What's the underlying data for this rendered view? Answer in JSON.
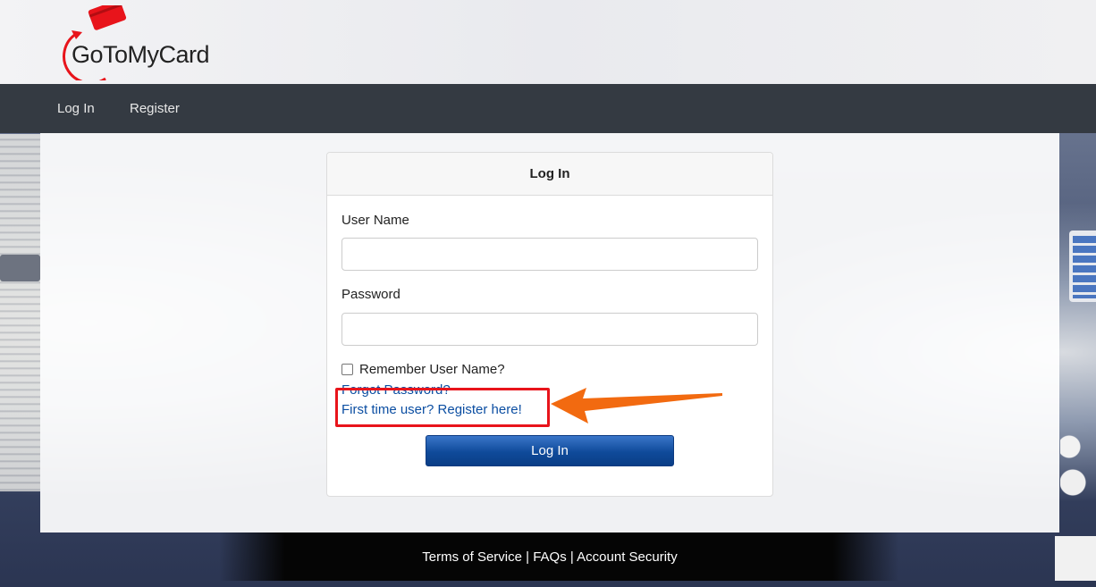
{
  "brand": {
    "name": "GoToMyCard",
    "logo_icon": "credit-card-circular-arrow-icon",
    "accent": "#e8141b"
  },
  "nav": {
    "items": [
      {
        "label": "Log In"
      },
      {
        "label": "Register"
      }
    ]
  },
  "login_card": {
    "title": "Log In",
    "username_label": "User Name",
    "username_value": "",
    "password_label": "Password",
    "password_value": "",
    "remember_label": "Remember User Name?",
    "remember_checked": false,
    "forgot_link": "Forgot Password?",
    "register_link": "First time user? Register here!",
    "submit_label": "Log In"
  },
  "footer": {
    "links": [
      "Terms of Service",
      "FAQs",
      "Account Security"
    ],
    "separator": "|"
  },
  "colors": {
    "navbar": "#343a42",
    "link": "#0b4ea2",
    "button": "#0f4a9a",
    "annotation_box": "#e8141b",
    "annotation_arrow": "#f26a10"
  }
}
